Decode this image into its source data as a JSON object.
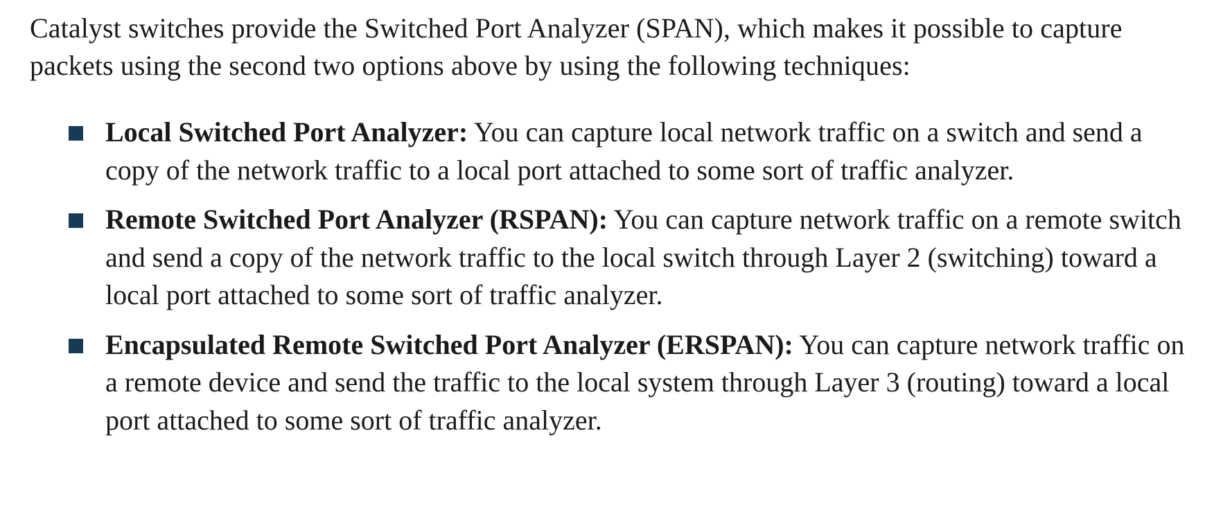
{
  "intro": "Catalyst switches provide the Switched Port Analyzer (SPAN), which makes it possible to capture packets using the second two options above by using the following techniques:",
  "colors": {
    "text": "#1b1b1b",
    "bullet": "#173a55"
  },
  "bullets": [
    {
      "term": "Local Switched Port Analyzer:",
      "text": " You can capture local network traffic on a switch and send a copy of the network traffic to a local port attached to some sort of traffic ana­lyzer."
    },
    {
      "term": "Remote Switched Port Analyzer (RSPAN):",
      "text": " You can capture network traffic on a remote switch and send a copy of the network traffic to the local switch through Layer 2 (switching) toward a local port attached to some sort of traffic analyzer."
    },
    {
      "term": "Encapsulated Remote Switched Port Analyzer (ERSPAN):",
      "text": " You can capture network traffic on a remote device and send the traffic to the local system through Layer 3 (routing) toward a local port attached to some sort of traffic analyzer."
    }
  ]
}
